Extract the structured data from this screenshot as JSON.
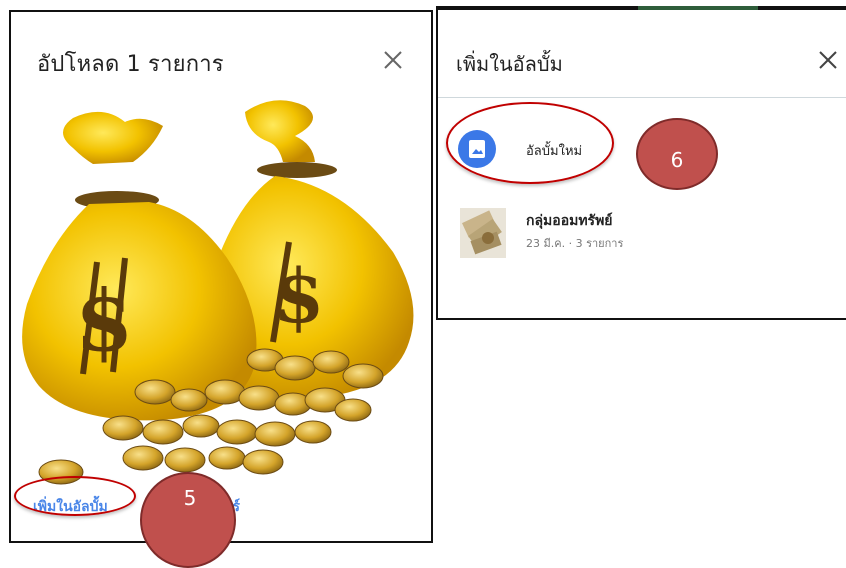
{
  "upload_dialog": {
    "title": "อัปโหลด 1 รายการ",
    "close_icon": "close-icon",
    "image": "money-bags-with-coins",
    "add_to_album_label": "เพิ่มในอัลบั้ม",
    "share_label_visible": "ชร์"
  },
  "annotations": {
    "step_5": "5",
    "step_6": "6",
    "highlight_color": "#c00000",
    "badge_color": "#c0504d"
  },
  "album_dialog": {
    "title": "เพิ่มในอัลบั้ม",
    "close_icon": "close-icon",
    "new_album": {
      "icon": "album-icon",
      "label": "อัลบั้มใหม่"
    },
    "albums": [
      {
        "name": "กลุ่มออมทรัพย์",
        "meta": "23 มี.ค. · 3 รายการ",
        "thumbnail": "banknotes-thumbnail"
      }
    ]
  },
  "colors": {
    "accent_blue": "#3b78e7",
    "link_blue": "#4a86e8",
    "divider": "#cfd8dc"
  }
}
